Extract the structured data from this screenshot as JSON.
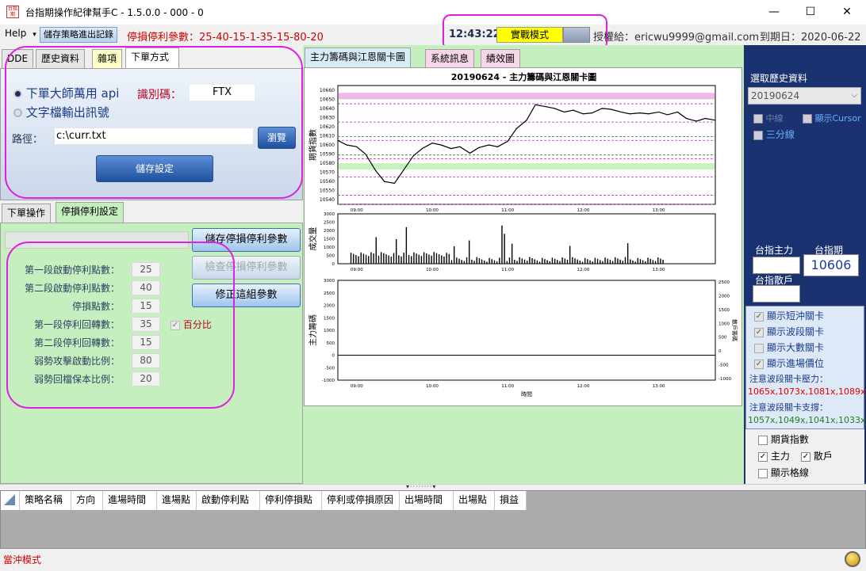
{
  "window": {
    "title": "台指期操作紀律幫手C - 1.5.0.0 - 000 - 0",
    "icon_text": "台指期",
    "minimize": "—",
    "maximize": "☐",
    "close": "✕"
  },
  "toolbar": {
    "help_label": "Help",
    "help_arrow": "▾",
    "save_log_label": "儲存策略進出記錄",
    "stoploss_params": "停損停利參數：25-40-15-1-35-15-80-20",
    "clock": "12:43:22",
    "mode_label": "實戰模式",
    "license": "授權給：ericwu9999@gmail.com",
    "expiry": "到期日：2020-06-22"
  },
  "top_tabs": [
    "DDE",
    "歷史資料",
    "雜項",
    "下單方式"
  ],
  "order_method": {
    "option_api": "下單大師萬用 api",
    "option_file": "文字檔輸出訊號",
    "id_label": "識別碼：",
    "id_value": "FTX",
    "path_label": "路徑：",
    "path_value": "c:\\curr.txt",
    "browse_label": "瀏覽",
    "save_label": "儲存設定"
  },
  "bottom_tabs": [
    "下單操作",
    "停損停利設定"
  ],
  "stoploss": {
    "save_btn": "儲存停損停利參數",
    "check_btn": "檢查停損停利參數",
    "fix_btn": "修正這組參數",
    "percent_label": "百分比",
    "params": [
      {
        "label": "第一段啟動停利點數：",
        "value": "25"
      },
      {
        "label": "第二段啟動停利點數：",
        "value": "40"
      },
      {
        "label": "停損點數：",
        "value": "15"
      },
      {
        "label": "第一段停利回轉數：",
        "value": "35"
      },
      {
        "label": "第二段停利回轉數：",
        "value": "15"
      },
      {
        "label": "弱勢攻擊啟動比例：",
        "value": "80"
      },
      {
        "label": "弱勢回檔保本比例：",
        "value": "20"
      }
    ]
  },
  "chart_tabs": [
    "主力籌碼與江恩關卡圖",
    "系統訊息",
    "績效圖"
  ],
  "chart_data": [
    {
      "type": "line",
      "title": "20190624 - 主力籌碼與江恩關卡圖",
      "ylabel": "期貨指數",
      "ylim": [
        10535,
        10665
      ],
      "y_ticks": [
        "10660",
        "10650",
        "10640",
        "10630",
        "10620",
        "10610",
        "10600",
        "10590",
        "10580",
        "10570",
        "10560",
        "10550",
        "10540"
      ],
      "x_ticks": [
        "09:00",
        "10:00",
        "11:00",
        "12:00",
        "13:00"
      ],
      "pressure_band": [
        10650,
        10657
      ],
      "support_band": [
        10573,
        10580
      ],
      "series": [
        {
          "x": [
            "08:45",
            "08:52",
            "09:00",
            "09:07",
            "09:15",
            "09:22",
            "09:30",
            "09:37",
            "09:45",
            "09:52",
            "10:00",
            "10:07",
            "10:15",
            "10:22",
            "10:30",
            "10:37",
            "10:45",
            "10:52",
            "11:00",
            "11:07",
            "11:15",
            "11:22",
            "11:30",
            "11:37",
            "11:45",
            "11:52",
            "12:00",
            "12:07",
            "12:15",
            "12:22",
            "12:30",
            "12:37",
            "12:45",
            "12:52",
            "13:00",
            "13:07",
            "13:15",
            "13:22",
            "13:30",
            "13:37",
            "13:45"
          ],
          "values": [
            10605,
            10600,
            10598,
            10590,
            10572,
            10560,
            10558,
            10572,
            10588,
            10596,
            10602,
            10600,
            10596,
            10598,
            10591,
            10597,
            10600,
            10598,
            10604,
            10618,
            10627,
            10644,
            10642,
            10640,
            10636,
            10638,
            10634,
            10635,
            10640,
            10639,
            10636,
            10634,
            10635,
            10634,
            10636,
            10633,
            10636,
            10629,
            10626,
            10629,
            10627
          ]
        }
      ]
    },
    {
      "type": "bar",
      "ylabel": "成交量",
      "ylim": [
        0,
        3000
      ],
      "y_ticks": [
        "3000",
        "2500",
        "2000",
        "1500",
        "1000",
        "500",
        "0"
      ],
      "x_ticks": [
        "09:00",
        "10:00",
        "11:00",
        "12:00",
        "13:00"
      ]
    },
    {
      "type": "line",
      "ylabel": "主力籌碼",
      "xlabel": "時間",
      "ylim": [
        -1000,
        3000
      ],
      "y_ticks": [
        "3000",
        "2500",
        "2000",
        "1500",
        "1000",
        "500",
        "0",
        "-500",
        "-1000"
      ],
      "right_ylabel": "散戶籌碼",
      "right_ticks": [
        "2500",
        "2000",
        "1500",
        "1000",
        "500",
        "0",
        "-500",
        "-1000"
      ],
      "x_ticks": [
        "09:00",
        "10:00",
        "11:00",
        "12:00",
        "13:00"
      ]
    }
  ],
  "right_panel": {
    "history_label": "選取歷史資料",
    "history_value": "20190624",
    "midline_label": "中線",
    "cursor_label": "顯示Cursor",
    "tri_label": "三分線",
    "main_force_label": "台指主力",
    "futures_label": "台指期",
    "futures_value": "10606",
    "retail_label": "台指散戶",
    "checks": [
      {
        "label": "顯示短沖關卡",
        "checked": true
      },
      {
        "label": "顯示波段關卡",
        "checked": true
      },
      {
        "label": "顯示大數關卡",
        "checked": false
      },
      {
        "label": "顯示進場價位",
        "checked": true
      }
    ],
    "pressure_title": "注意波段關卡壓力：",
    "pressure_values": "1065x,1073x,1081x,1089x",
    "support_title": "注意波段關卡支撐：",
    "support_values": "1057x,1049x,1041x,1033x",
    "futures_index_label": "期貨指數",
    "main_label": "主力",
    "retail_short_label": "散戶",
    "grid_label": "顯示格線"
  },
  "table": {
    "columns": [
      "策略名稱",
      "方向",
      "進場時間",
      "進場點",
      "啟動停利點",
      "停利停損點",
      "停利或停損原因",
      "出場時間",
      "出場點",
      "損益"
    ]
  },
  "status": {
    "mode": "當沖模式"
  },
  "colors": {
    "accent_red": "#d00000",
    "highlight_magenta": "#e020e0",
    "mode_yellow": "#ffff00",
    "panel_green": "#c6efc0"
  }
}
